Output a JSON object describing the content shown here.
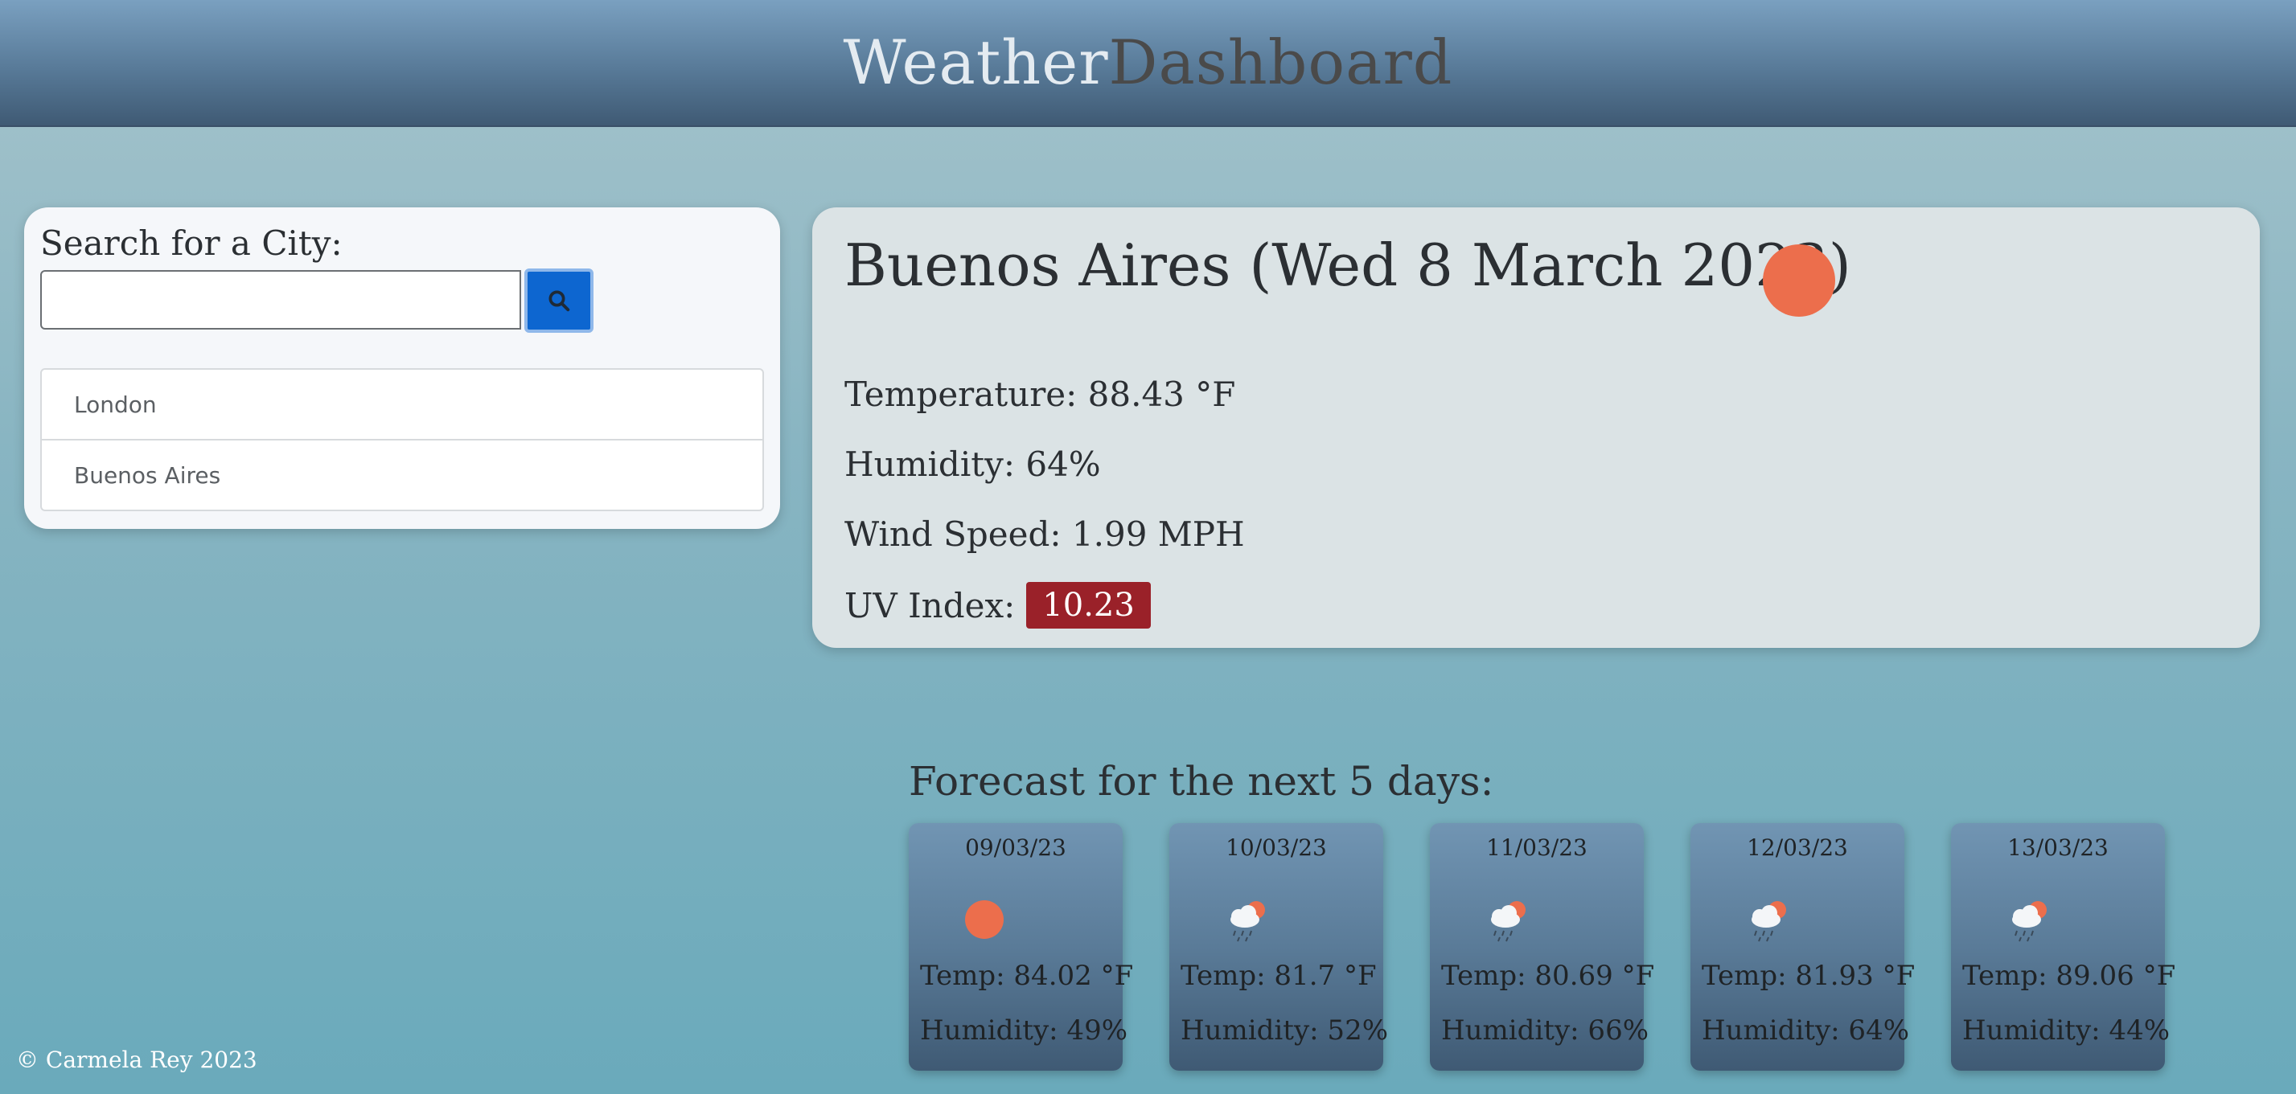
{
  "header": {
    "brand_part1": "Weather",
    "brand_part2": "Dashboard"
  },
  "search": {
    "label": "Search for a City:",
    "input_value": "",
    "placeholder": "",
    "button_icon": "search-icon",
    "history": [
      {
        "label": "London"
      },
      {
        "label": "Buenos Aires"
      }
    ]
  },
  "current": {
    "title": "Buenos Aires (Wed 8 March 2023)",
    "icon": "sun-icon",
    "temperature": "Temperature: 88.43 °F",
    "humidity": "Humidity: 64%",
    "wind": "Wind Speed: 1.99 MPH",
    "uv_label": "UV Index:",
    "uv_value": "10.23",
    "uv_color": "#9a2129"
  },
  "forecast": {
    "heading": "Forecast for the next 5 days:",
    "days": [
      {
        "date": "09/03/23",
        "icon": "sun-icon",
        "temp": "Temp: 84.02 °F",
        "humidity": "Humidity: 49%"
      },
      {
        "date": "10/03/23",
        "icon": "rain-cloud-sun-icon",
        "temp": "Temp: 81.7 °F",
        "humidity": "Humidity: 52%"
      },
      {
        "date": "11/03/23",
        "icon": "rain-cloud-sun-icon",
        "temp": "Temp: 80.69 °F",
        "humidity": "Humidity: 66%"
      },
      {
        "date": "12/03/23",
        "icon": "rain-cloud-sun-icon",
        "temp": "Temp: 81.93 °F",
        "humidity": "Humidity: 64%"
      },
      {
        "date": "13/03/23",
        "icon": "rain-cloud-sun-icon",
        "temp": "Temp: 89.06 °F",
        "humidity": "Humidity: 44%"
      }
    ]
  },
  "footer": {
    "text": "© Carmela Rey 2023"
  },
  "colors": {
    "accent": "#0d66d0",
    "sun": "#ec6e4c"
  }
}
